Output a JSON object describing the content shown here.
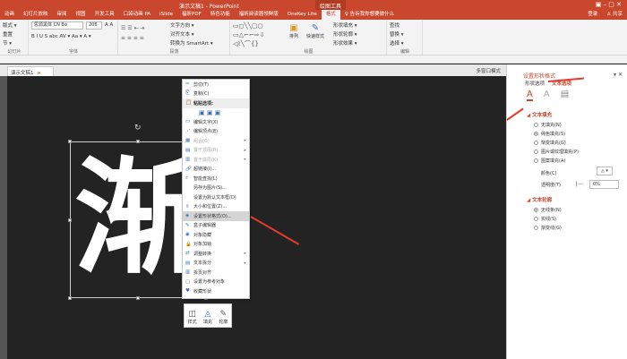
{
  "title": "演示文稿1 - PowerPoint",
  "context_tab": "绘图工具",
  "window_controls": "▣ – ▢ ✕",
  "tabs": [
    "动画",
    "幻灯片放映",
    "审阅",
    "视图",
    "开发工具",
    "口袋动画 PA",
    "iSlide",
    "福昕PDF",
    "特色功能",
    "福昕阅读器领鲜版",
    "OneKey Lite",
    "格式"
  ],
  "tell_me": "♀ 告诉我你想要做什么",
  "login": "登录",
  "share": "♙ 共享",
  "ribbon": {
    "slides": {
      "items": [
        "版式 ▾",
        "重置",
        "节 ▾"
      ],
      "label": "幻灯片"
    },
    "font": {
      "name": "思源黑体 CN Bo",
      "size": "206",
      "fmt": "B I U S abc AV ▾ Aa ▾ A ▾",
      "label": "字体"
    },
    "para": {
      "items": [
        "文字方向 ▾",
        "对齐文本 ▾",
        "转换为 SmartArt ▾"
      ],
      "label": "段落"
    },
    "drawing": {
      "items": [
        "排列",
        "快速样式",
        "形状填充 ▾",
        "形状轮廓 ▾",
        "形状效果 ▾"
      ],
      "label": "绘图"
    },
    "editing": {
      "items": [
        "查找",
        "替换 ▾",
        "选择 ▾"
      ],
      "label": "编辑"
    }
  },
  "document_tab": "演示文稿1",
  "multi_window": "多窗口模式",
  "slide_text": "渐",
  "context_menu": [
    {
      "icon": "✂",
      "label": "剪切(T)"
    },
    {
      "icon": "⎘",
      "label": "复制(C)"
    },
    {
      "icon": "📋",
      "label": "粘贴选项:",
      "head": true
    },
    {
      "icon": "",
      "label": "▣ ▣ ▣"
    },
    {
      "icon": "▭",
      "label": "编辑文字(X)"
    },
    {
      "icon": "⋰",
      "label": "编辑顶点(E)"
    },
    {
      "icon": "▦",
      "label": "组合(G)",
      "disabled": true,
      "sub": true
    },
    {
      "icon": "▤",
      "label": "置于顶层(R)",
      "disabled": true,
      "sub": true
    },
    {
      "icon": "▥",
      "label": "置于底层(K)",
      "disabled": true,
      "sub": true
    },
    {
      "icon": "🔗",
      "label": "超链接(I)..."
    },
    {
      "icon": "⌕",
      "label": "智能查找(L)"
    },
    {
      "icon": "",
      "label": "另存为图片(S)..."
    },
    {
      "icon": "",
      "label": "设置为默认文本框(D)"
    },
    {
      "icon": "⇳",
      "label": "大小和位置(Z)..."
    },
    {
      "icon": "◈",
      "label": "设置形状格式(O)...",
      "highlight": true
    },
    {
      "icon": "✎",
      "label": "盒子编辑器"
    },
    {
      "icon": "◉",
      "label": "对象隐藏"
    },
    {
      "icon": "🔒",
      "label": "对象加锁"
    },
    {
      "icon": "⇄",
      "label": "调整转换",
      "sub": true
    },
    {
      "icon": "▤",
      "label": "文本拆分",
      "sub": true
    },
    {
      "icon": "▥",
      "label": "拆页对齐"
    },
    {
      "icon": "▢",
      "label": "设置为参考对象"
    },
    {
      "icon": "♥",
      "label": "收藏形状"
    }
  ],
  "mini_toolbar": [
    "样式",
    "填充",
    "轮廓"
  ],
  "panel": {
    "title": "设置形状格式",
    "tabs": [
      "形状选项",
      "文本选项"
    ],
    "fill_section": "文本填充",
    "fill_options": [
      "无填充(N)",
      "纯色填充(S)",
      "渐变填充(G)",
      "图片或纹理填充(P)",
      "图案填充(A)"
    ],
    "color_label": "颜色(C)",
    "transparency_label": "透明度(T)",
    "transparency_value": "0%",
    "outline_section": "文本轮廓",
    "outline_options": [
      "无线条(N)",
      "实线(S)",
      "渐变线(G)"
    ]
  },
  "accent": "#c8472d"
}
